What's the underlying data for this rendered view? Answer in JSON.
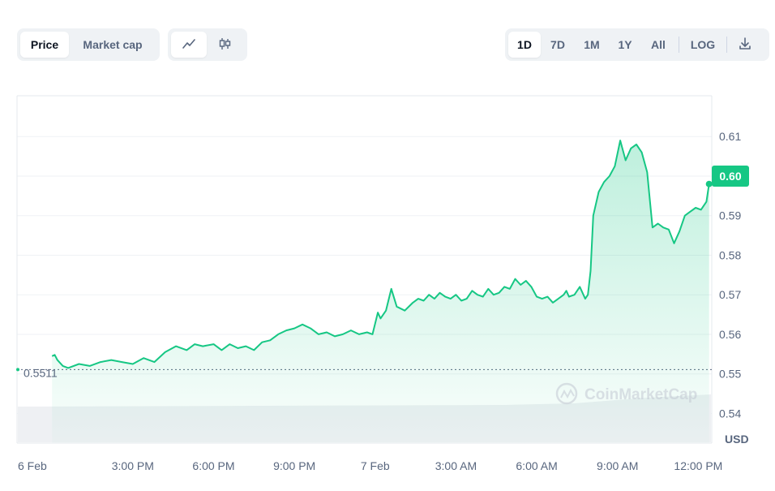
{
  "toolbar": {
    "type_buttons": [
      {
        "label": "Price",
        "active": true
      },
      {
        "label": "Market cap",
        "active": false
      }
    ],
    "view_icons": [
      {
        "icon": "line-chart-icon",
        "active": true
      },
      {
        "icon": "candlestick-icon",
        "active": false
      }
    ],
    "ranges": [
      {
        "label": "1D",
        "active": true
      },
      {
        "label": "7D",
        "active": false
      },
      {
        "label": "1M",
        "active": false
      },
      {
        "label": "1Y",
        "active": false
      },
      {
        "label": "All",
        "active": false
      }
    ],
    "log_label": "LOG",
    "download_icon": "download-icon"
  },
  "colors": {
    "line": "#16c784",
    "badge": "#16c784",
    "grid": "#eff2f5",
    "text": "#58667e",
    "volume": "#eef0f3"
  },
  "watermark": "CoinMarketCap",
  "chart_data": {
    "type": "area",
    "currency_label": "USD",
    "open_price_label": "0.5511",
    "current_price_label": "0.60",
    "y_ticks": [
      "0.61",
      "0.60",
      "0.59",
      "0.58",
      "0.57",
      "0.56",
      "0.55",
      "0.54"
    ],
    "ylim": [
      0.5325,
      0.6203
    ],
    "x_tick_labels": [
      "6 Feb",
      "3:00 PM",
      "6:00 PM",
      "9:00 PM",
      "7 Feb",
      "3:00 AM",
      "6:00 AM",
      "9:00 AM",
      "12:00 PM"
    ],
    "x_tick_hours": [
      0,
      3,
      6,
      9,
      12,
      15,
      18,
      21,
      24
    ],
    "xlim_hours": [
      -1.3,
      24.5
    ],
    "reference_line": 0.5511,
    "series": [
      {
        "x_hours": [
          0.0,
          0.1,
          0.2,
          0.4,
          0.6,
          1.0,
          1.4,
          1.8,
          2.2,
          2.6,
          3.0,
          3.4,
          3.8,
          4.2,
          4.6,
          5.0,
          5.3,
          5.6,
          6.0,
          6.3,
          6.6,
          6.9,
          7.2,
          7.5,
          7.8,
          8.1,
          8.4,
          8.7,
          9.0,
          9.3,
          9.6,
          9.9,
          10.2,
          10.5,
          10.8,
          11.1,
          11.4,
          11.7,
          11.9,
          12.1,
          12.2,
          12.4,
          12.6,
          12.8,
          13.1,
          13.4,
          13.6,
          13.8,
          14.0,
          14.2,
          14.4,
          14.6,
          14.8,
          15.0,
          15.2,
          15.4,
          15.6,
          15.8,
          16.0,
          16.2,
          16.4,
          16.6,
          16.8,
          17.0,
          17.2,
          17.4,
          17.6,
          17.8,
          18.0,
          18.2,
          18.4,
          18.6,
          18.8,
          19.0,
          19.1,
          19.2,
          19.4,
          19.6,
          19.8,
          19.9,
          20.0,
          20.1,
          20.3,
          20.5,
          20.7,
          20.9,
          21.1,
          21.3,
          21.5,
          21.7,
          21.9,
          22.1,
          22.3,
          22.5,
          22.7,
          22.9,
          23.1,
          23.3,
          23.5,
          23.7,
          23.9,
          24.1,
          24.3
        ],
        "values": [
          0.5545,
          0.5548,
          0.5535,
          0.552,
          0.5515,
          0.5525,
          0.552,
          0.553,
          0.5535,
          0.553,
          0.5525,
          0.554,
          0.553,
          0.5555,
          0.557,
          0.556,
          0.5575,
          0.557,
          0.5575,
          0.556,
          0.5575,
          0.5565,
          0.557,
          0.556,
          0.558,
          0.5585,
          0.56,
          0.561,
          0.5615,
          0.5625,
          0.5615,
          0.56,
          0.5605,
          0.5595,
          0.56,
          0.561,
          0.56,
          0.5605,
          0.56,
          0.5655,
          0.564,
          0.566,
          0.5715,
          0.567,
          0.566,
          0.568,
          0.569,
          0.5685,
          0.57,
          0.569,
          0.5705,
          0.5695,
          0.569,
          0.57,
          0.5685,
          0.569,
          0.571,
          0.57,
          0.5695,
          0.5715,
          0.57,
          0.5705,
          0.572,
          0.5715,
          0.574,
          0.5725,
          0.5735,
          0.572,
          0.5695,
          0.569,
          0.5695,
          0.568,
          0.569,
          0.57,
          0.571,
          0.5695,
          0.57,
          0.572,
          0.569,
          0.57,
          0.576,
          0.59,
          0.596,
          0.5985,
          0.6,
          0.6025,
          0.609,
          0.604,
          0.607,
          0.608,
          0.606,
          0.601,
          0.587,
          0.588,
          0.587,
          0.5865,
          0.583,
          0.586,
          0.59,
          0.591,
          0.592,
          0.5915,
          0.5935
        ]
      }
    ],
    "last_point": {
      "x_hours": 24.4,
      "value": 0.598
    }
  }
}
